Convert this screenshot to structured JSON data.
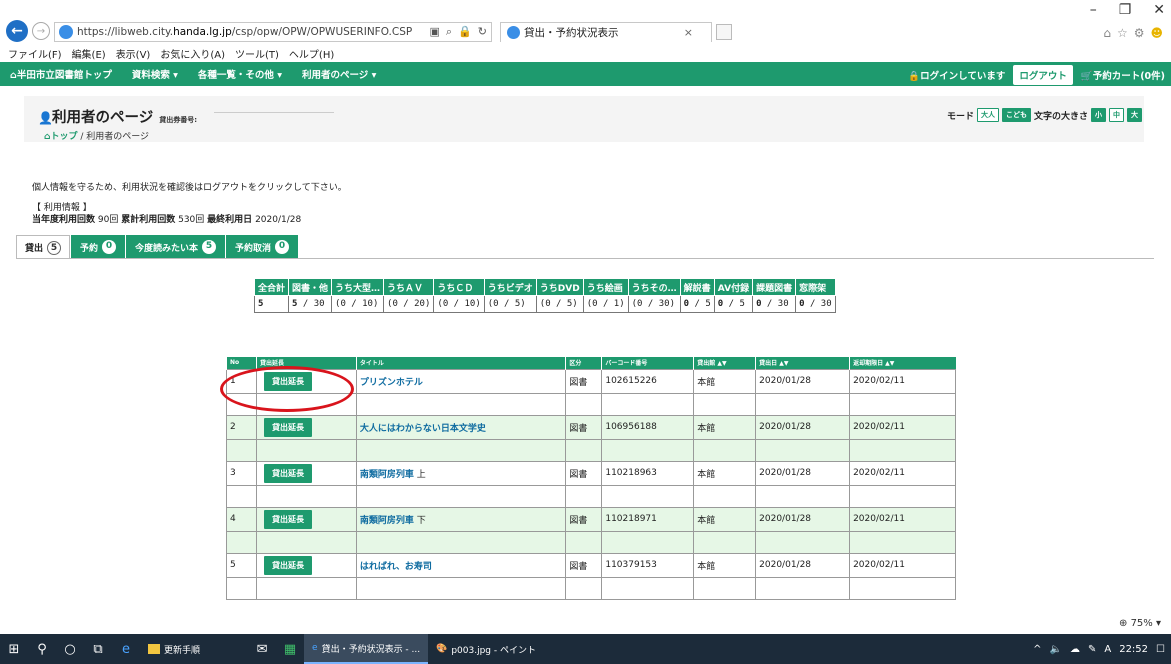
{
  "browser": {
    "url_prefix": "https://libweb.city.",
    "url_domain": "handa.lg.jp",
    "url_path": "/csp/opw/OPW/OPWUSERINFO.CSP",
    "tab_title": "貸出・予約状況表示",
    "menu": [
      "ファイル(F)",
      "編集(E)",
      "表示(V)",
      "お気に入り(A)",
      "ツール(T)",
      "ヘルプ(H)"
    ]
  },
  "sitenav": {
    "home": "半田市立図書館トップ",
    "items": [
      "資料検索 ▾",
      "各種一覧・その他 ▾",
      "利用者のページ ▾"
    ],
    "login_status": "ログインしています",
    "logout": "ログアウト",
    "cart": "予約カート(0件)"
  },
  "header": {
    "title": "利用者のページ",
    "card_label": "貸出券番号:",
    "mode_label": "モード",
    "mode_adult": "大人",
    "mode_child": "こども",
    "font_size_label": "文字の大きさ",
    "size_small": "小",
    "size_medium": "中",
    "size_large": "大",
    "breadcrumb_home": "トップ",
    "breadcrumb_sep": " / ",
    "breadcrumb_current": "利用者のページ"
  },
  "notice": "個人情報を守るため、利用状況を確認後はログアウトをクリックして下さい。",
  "usage": {
    "heading": "【 利用情報 】",
    "this_year_label": "当年度利用回数",
    "this_year_value": "90回",
    "total_label": "累計利用回数",
    "total_value": "530回",
    "last_label": "最終利用日",
    "last_value": "2020/1/28"
  },
  "tabs": [
    {
      "label": "貸出",
      "count": "5"
    },
    {
      "label": "予約",
      "count": "0"
    },
    {
      "label": "今度読みたい本",
      "count": "5"
    },
    {
      "label": "予約取消",
      "count": "0"
    }
  ],
  "counts": {
    "headers": [
      "全合計",
      "図書・他",
      "うち大型…",
      "うちＡＶ",
      "うちＣＤ",
      "うちビデオ",
      "うちDVD",
      "うち絵画",
      "うちその…",
      "解説書",
      "AV付録",
      "課題図書",
      "窓際架"
    ],
    "values": [
      {
        "b": "5",
        "r": ""
      },
      {
        "b": "5",
        "r": " / 30"
      },
      {
        "b": "",
        "r": "(0 / 10)"
      },
      {
        "b": "",
        "r": "(0 / 20)"
      },
      {
        "b": "",
        "r": "(0 / 10)"
      },
      {
        "b": "",
        "r": "(0 / 5)"
      },
      {
        "b": "",
        "r": "(0 / 5)"
      },
      {
        "b": "",
        "r": "(0 / 1)"
      },
      {
        "b": "",
        "r": "(0 / 30)"
      },
      {
        "b": "0",
        "r": " / 5"
      },
      {
        "b": "0",
        "r": " / 5"
      },
      {
        "b": "0",
        "r": " / 30"
      },
      {
        "b": "0",
        "r": " / 30"
      }
    ]
  },
  "loans": {
    "headers": [
      "No",
      "貸出延長",
      "タイトル",
      "区分",
      "バーコード番号",
      "貸出館 ▲▼",
      "貸出日 ▲▼",
      "返却期限日 ▲▼"
    ],
    "extend_label": "貸出延長",
    "rows": [
      {
        "no": "1",
        "title": "プリズンホテル",
        "title_suffix": "",
        "type": "図書",
        "barcode": "102615226",
        "branch": "本館",
        "date": "2020/01/28",
        "due": "2020/02/11"
      },
      {
        "no": "2",
        "title": "大人にはわからない日本文学史",
        "title_suffix": "",
        "type": "図書",
        "barcode": "106956188",
        "branch": "本館",
        "date": "2020/01/28",
        "due": "2020/02/11"
      },
      {
        "no": "3",
        "title": "南類阿房列車",
        "title_suffix": " 上",
        "type": "図書",
        "barcode": "110218963",
        "branch": "本館",
        "date": "2020/01/28",
        "due": "2020/02/11"
      },
      {
        "no": "4",
        "title": "南類阿房列車",
        "title_suffix": " 下",
        "type": "図書",
        "barcode": "110218971",
        "branch": "本館",
        "date": "2020/01/28",
        "due": "2020/02/11"
      },
      {
        "no": "5",
        "title": "はればれ、お寿司",
        "title_suffix": "",
        "type": "図書",
        "barcode": "110379153",
        "branch": "本館",
        "date": "2020/01/28",
        "due": "2020/02/11"
      }
    ]
  },
  "statusbar": {
    "zoom": "75%"
  },
  "taskbar": {
    "app1": "更新手順",
    "app2": "貸出・予約状況表示 - ...",
    "app3": "p003.jpg - ペイント",
    "ime": "A",
    "time": "22:52"
  },
  "colors": {
    "brand_green": "#1e9a6e",
    "row_alt": "#e6f7e6",
    "link": "#0e6ba0",
    "annotation_red": "#d9141c"
  }
}
